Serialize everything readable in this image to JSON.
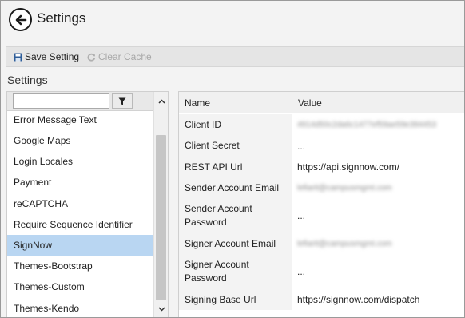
{
  "window": {
    "title": "Settings"
  },
  "toolbar": {
    "save_label": "Save Setting",
    "clear_cache_label": "Clear Cache"
  },
  "section_label": "Settings",
  "filter": {
    "value": "",
    "placeholder": ""
  },
  "list": {
    "items": [
      {
        "label": "Error Message Text"
      },
      {
        "label": "Google Maps"
      },
      {
        "label": "Login Locales"
      },
      {
        "label": "Payment"
      },
      {
        "label": "reCAPTCHA"
      },
      {
        "label": "Require Sequence Identifier"
      },
      {
        "label": "SignNow",
        "selected": true
      },
      {
        "label": "Themes-Bootstrap"
      },
      {
        "label": "Themes-Custom"
      },
      {
        "label": "Themes-Kendo"
      }
    ]
  },
  "grid": {
    "columns": {
      "name": "Name",
      "value": "Value"
    },
    "rows": [
      {
        "name": "Client ID",
        "value": "4914d50c2da6c1477ef59ae59e394453"
      },
      {
        "name": "Client Secret",
        "value": "..."
      },
      {
        "name": "REST API Url",
        "value": "https://api.signnow.com/"
      },
      {
        "name": "Sender Account Email",
        "value": "lefiarit@campusmgmt.com"
      },
      {
        "name": "Sender Account Password",
        "value": "..."
      },
      {
        "name": "Signer Account Email",
        "value": "lefiarit@campusmgmt.com"
      },
      {
        "name": "Signer Account Password",
        "value": "..."
      },
      {
        "name": "Signing Base Url",
        "value": "https://signnow.com/dispatch"
      }
    ]
  },
  "colors": {
    "selected_row": "#b9d6f2",
    "toolbar_bg": "#e5e5e5",
    "disabled_text": "#a8a8a8"
  }
}
